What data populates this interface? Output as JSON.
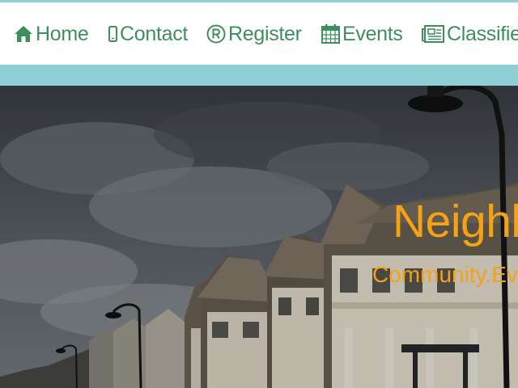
{
  "nav": {
    "items": [
      {
        "label": "Home",
        "icon": "home-icon"
      },
      {
        "label": "Contact",
        "icon": "mobile-phone-icon"
      },
      {
        "label": "Register",
        "icon": "registered-icon"
      },
      {
        "label": "Events",
        "icon": "calendar-icon"
      },
      {
        "label": "Classifieds",
        "icon": "newspaper-icon"
      }
    ]
  },
  "hero": {
    "title": "Neighborhood",
    "subtitle": "Community.Events"
  },
  "colors": {
    "accent_teal": "#8ecfd6",
    "nav_text": "#3f8f5e",
    "hero_text": "#f5a216"
  }
}
